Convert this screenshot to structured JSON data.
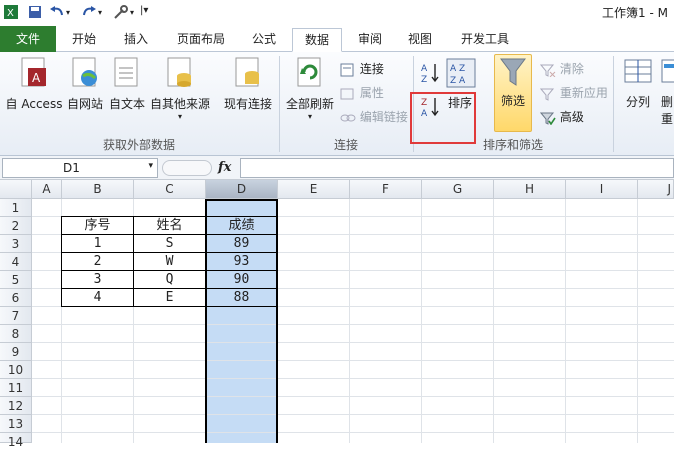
{
  "window": {
    "title": "工作簿1 - M"
  },
  "quick_access": [
    "save-icon",
    "undo-icon",
    "redo-icon",
    "tools-icon"
  ],
  "tabs": [
    {
      "label": "文件"
    },
    {
      "label": "开始"
    },
    {
      "label": "插入"
    },
    {
      "label": "页面布局"
    },
    {
      "label": "公式"
    },
    {
      "label": "数据"
    },
    {
      "label": "审阅"
    },
    {
      "label": "视图"
    },
    {
      "label": "开发工具"
    }
  ],
  "active_tab": "数据",
  "ribbon": {
    "get_external": {
      "access": "自 Access",
      "web": "自网站",
      "text": "自文本",
      "other": "自其他来源",
      "existing": "现有连接",
      "group": "获取外部数据"
    },
    "connections": {
      "refresh_all": "全部刷新",
      "connections": "连接",
      "properties": "属性",
      "edit_links": "编辑链接",
      "group": "连接"
    },
    "sort_filter": {
      "sort": "排序",
      "filter": "筛选",
      "clear": "清除",
      "reapply": "重新应用",
      "advanced": "高级",
      "group": "排序和筛选"
    },
    "data_tools": {
      "split": "分列",
      "partial1": "删",
      "partial2": "重"
    }
  },
  "formula_bar": {
    "name_box": "D1",
    "fx": "fx",
    "formula": ""
  },
  "columns": [
    "A",
    "B",
    "C",
    "D",
    "E",
    "F",
    "G",
    "H",
    "I",
    "J"
  ],
  "rows": [
    "1",
    "2",
    "3",
    "4",
    "5",
    "6",
    "7",
    "8",
    "9",
    "10",
    "11",
    "12",
    "13",
    "14"
  ],
  "table": {
    "headers": [
      "序号",
      "姓名",
      "成绩"
    ],
    "rows": [
      [
        "1",
        "S",
        "89"
      ],
      [
        "2",
        "W",
        "93"
      ],
      [
        "3",
        "Q",
        "90"
      ],
      [
        "4",
        "E",
        "88"
      ]
    ]
  },
  "selected_column": "D",
  "colors": {
    "file_tab": "#2d7d2f",
    "selection": "#c5dcf5",
    "highlight_box": "#e03a3a"
  }
}
